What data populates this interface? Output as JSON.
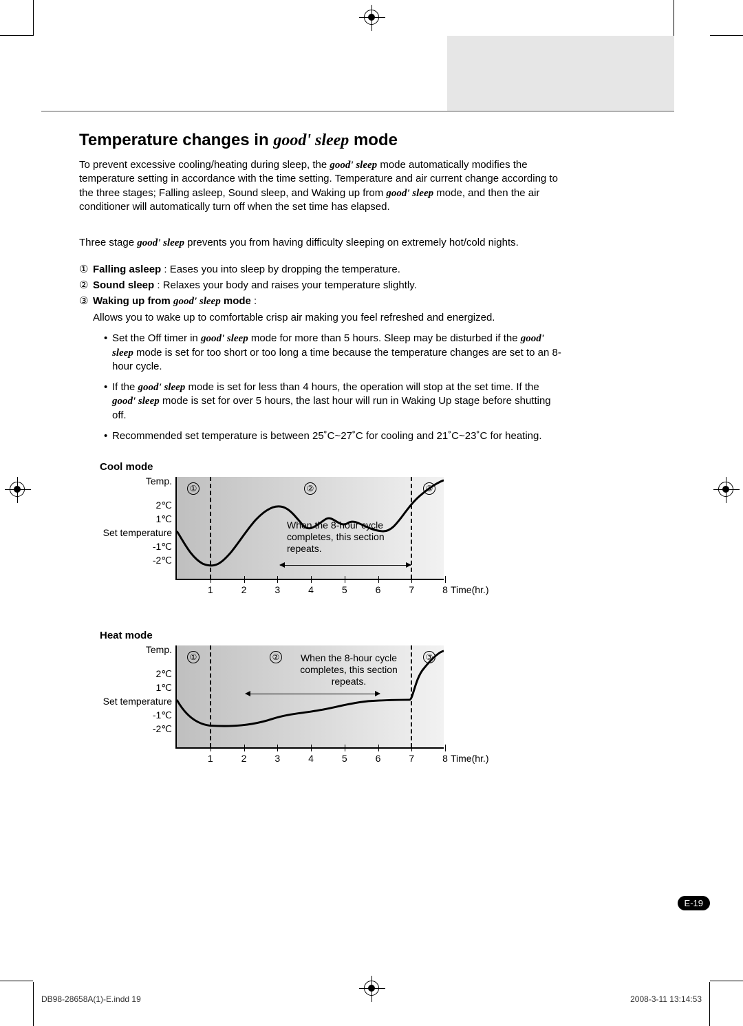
{
  "heading": {
    "pre": "Temperature changes in ",
    "gs": "good' sleep",
    "post": " mode"
  },
  "intro": {
    "p1a": "To prevent excessive cooling/heating during sleep, the ",
    "p1b": " mode automatically modifies the temperature setting in accordance with the time setting. Temperature and air current change according to the three stages; Falling asleep, Sound sleep, and Waking up from ",
    "p1c": " mode, and then the air conditioner will automatically turn off when the set time has elapsed."
  },
  "stage_intro": {
    "a": "Three stage ",
    "b": " prevents you from having difficulty sleeping on extremely hot/cold nights."
  },
  "stages": {
    "n1": "①",
    "s1t": "Falling asleep",
    "s1b": " : Eases you into sleep by dropping the temperature.",
    "n2": "②",
    "s2t": "Sound sleep",
    "s2b": " : Relaxes your body and raises your temperature slightly.",
    "n3": "③",
    "s3t_a": "Waking up from ",
    "s3t_b": " mode",
    "s3b": " :",
    "s3sub": "Allows you to wake up to comfortable crisp air making you feel refreshed and energized."
  },
  "bullets": {
    "b1a": "Set the Off timer in ",
    "b1b": " mode for more than 5 hours. Sleep may be disturbed if the ",
    "b1c": " mode is set for too short or too long a time because the temperature changes are set to an 8-hour cycle.",
    "b2a": "If the ",
    "b2b": " mode is set for less than 4 hours, the operation will stop at the set time. If the ",
    "b2c": " mode is set for over 5 hours, the last hour will run in Waking Up stage before shutting off.",
    "b3": "Recommended set temperature is between 25˚C~27˚C for cooling and 21˚C~23˚C for heating."
  },
  "cool": {
    "title": "Cool mode",
    "ylab_top": "Temp.",
    "set_temp": "Set temperature",
    "note": "When the 8-hour cycle completes, this section repeats.",
    "xlab": "Time(hr.)"
  },
  "heat": {
    "title": "Heat mode",
    "ylab_top": "Temp.",
    "set_temp": "Set temperature",
    "note": "When the 8-hour cycle completes, this section repeats.",
    "xlab": "Time(hr.)"
  },
  "yticks": [
    "2℃",
    "1℃",
    "-1℃",
    "-2℃"
  ],
  "xticks": [
    "1",
    "2",
    "3",
    "4",
    "5",
    "6",
    "7",
    "8"
  ],
  "stage_marks": [
    "①",
    "②",
    "③"
  ],
  "gs": "good' sleep",
  "page_badge": "E-19",
  "footer": {
    "doc": "DB98-28658A(1)-E.indd   19",
    "stamp": "2008-3-11   13:14:53"
  },
  "chart_data": [
    {
      "type": "line",
      "title": "Cool mode",
      "xlabel": "Time(hr.)",
      "ylabel": "Temp.",
      "xlim": [
        0,
        8
      ],
      "ylim": [
        -2.5,
        2.5
      ],
      "stage_boundaries": [
        1,
        7
      ],
      "repeat_section": [
        3,
        7
      ],
      "note": "When the 8-hour cycle completes, this section repeats.",
      "yticks": [
        -2,
        -1,
        0,
        1,
        2
      ],
      "ytick_labels": [
        "-2℃",
        "-1℃",
        "Set temperature",
        "1℃",
        "2℃"
      ],
      "x": [
        0,
        0.5,
        1,
        1.5,
        2,
        2.6,
        3.2,
        3.8,
        4.3,
        4.8,
        5.3,
        5.8,
        6.3,
        7,
        7.4,
        8
      ],
      "y": [
        0,
        -1.6,
        -2.3,
        -2.0,
        -0.8,
        0.7,
        1.6,
        1.2,
        0.5,
        1.0,
        0.4,
        0.9,
        0.5,
        0.3,
        1.6,
        2.4
      ]
    },
    {
      "type": "line",
      "title": "Heat mode",
      "xlabel": "Time(hr.)",
      "ylabel": "Temp.",
      "xlim": [
        0,
        8
      ],
      "ylim": [
        -2.5,
        2.5
      ],
      "stage_boundaries": [
        1,
        7
      ],
      "repeat_section": [
        2,
        6
      ],
      "note": "When the 8-hour cycle completes, this section repeats.",
      "yticks": [
        -2,
        -1,
        0,
        1,
        2
      ],
      "ytick_labels": [
        "-2℃",
        "-1℃",
        "Set temperature",
        "1℃",
        "2℃"
      ],
      "x": [
        0,
        0.5,
        1,
        2,
        2.8,
        3.5,
        4.2,
        5.0,
        5.5,
        6.2,
        7.0,
        7.3,
        8
      ],
      "y": [
        0,
        -1.2,
        -1.7,
        -1.8,
        -1.5,
        -1.0,
        -0.9,
        -0.6,
        -0.2,
        0.0,
        0.0,
        1.2,
        2.2
      ]
    }
  ]
}
